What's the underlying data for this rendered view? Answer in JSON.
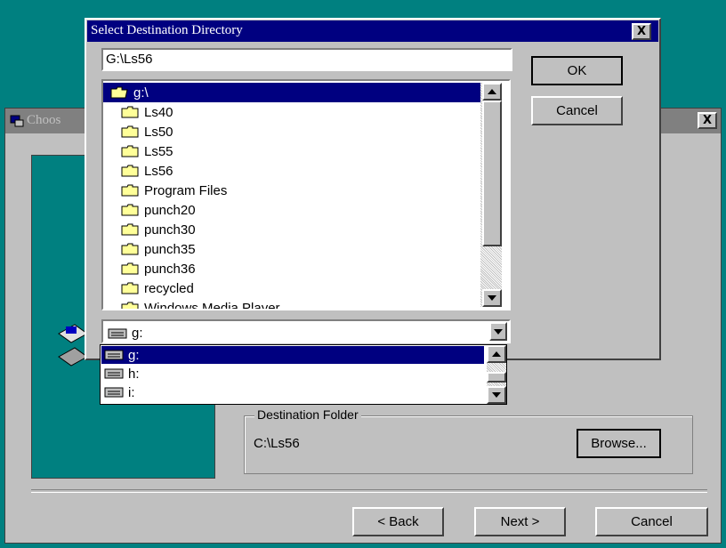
{
  "background_window": {
    "title": "Choos",
    "close_label": "X",
    "destination_group_label": "Destination Folder",
    "destination_path": "C:\\Ls56",
    "browse_label": "Browse...",
    "back_label": "< Back",
    "next_label": "Next >",
    "cancel_label": "Cancel"
  },
  "dialog": {
    "title": "Select Destination Directory",
    "close_label": "X",
    "path_value": "G:\\Ls56",
    "ok_label": "OK",
    "cancel_label": "Cancel",
    "root_item": "g:\\",
    "folders": [
      "Ls40",
      "Ls50",
      "Ls55",
      "Ls56",
      "Program Files",
      "punch20",
      "punch30",
      "punch35",
      "punch36",
      "recycled",
      "Windows Media Player"
    ],
    "drive_selected": "g:",
    "drive_options": [
      "g:",
      "h:",
      "i:"
    ]
  },
  "colors": {
    "teal": "#008080",
    "selection": "#000080",
    "face": "#c0c0c0"
  }
}
